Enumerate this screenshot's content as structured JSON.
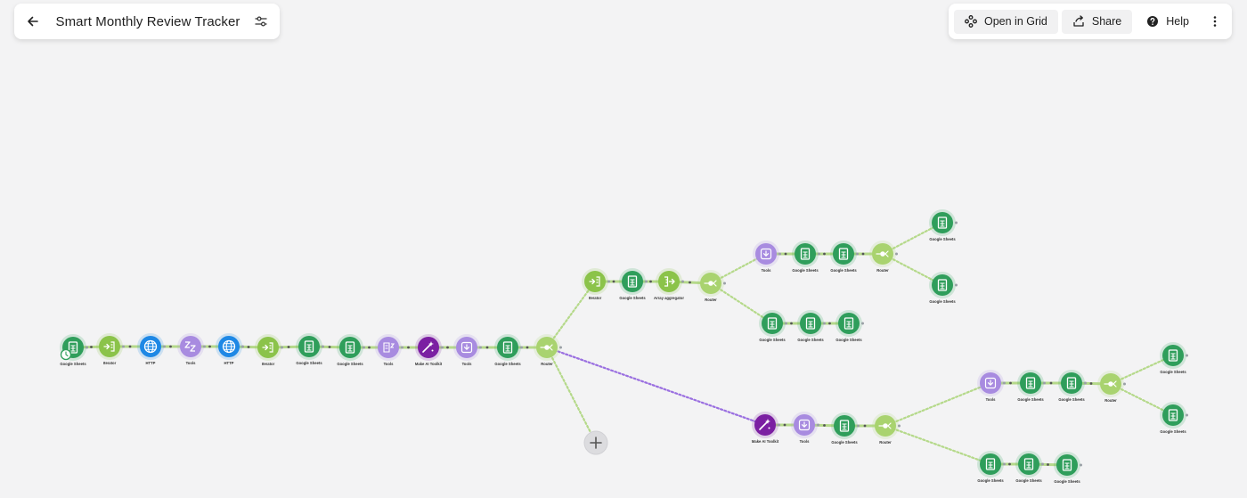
{
  "header": {
    "title": "Smart Monthly Review Tracker"
  },
  "toolbar": {
    "open_in_grid": "Open in Grid",
    "share": "Share",
    "help": "Help"
  },
  "colors": {
    "sheets": "#2f9e5b",
    "tools": "#8bc34a",
    "http": "#1e88e5",
    "ai": "#7b1fa2",
    "purple_light": "#a88be0",
    "canvas": "#f3f3f4"
  },
  "modules": [
    {
      "id": "m1",
      "kind": "sheets",
      "label": "Google Sheets"
    },
    {
      "id": "m2",
      "kind": "tools",
      "label": "Iterator"
    },
    {
      "id": "m3",
      "kind": "http",
      "label": "HTTP"
    },
    {
      "id": "m4",
      "kind": "sleep",
      "label": "Tools"
    },
    {
      "id": "m5",
      "kind": "http",
      "label": "HTTP"
    },
    {
      "id": "m6",
      "kind": "tools",
      "label": "Iterator"
    },
    {
      "id": "m7",
      "kind": "sheets",
      "label": "Google Sheets"
    },
    {
      "id": "m8",
      "kind": "sheets",
      "label": "Google Sheets"
    },
    {
      "id": "m9",
      "kind": "aggregator",
      "label": "Tools"
    },
    {
      "id": "m10",
      "kind": "ai",
      "label": "Make AI Toolkit"
    },
    {
      "id": "m11",
      "kind": "setvar",
      "label": "Tools"
    },
    {
      "id": "m12",
      "kind": "sheets",
      "label": "Google Sheets"
    },
    {
      "id": "m13",
      "kind": "router",
      "label": "Router"
    },
    {
      "id": "u1",
      "kind": "tools",
      "label": "Iterator"
    },
    {
      "id": "u2",
      "kind": "sheets",
      "label": "Google Sheets"
    },
    {
      "id": "u3",
      "kind": "arrayagg",
      "label": "Array aggregator"
    },
    {
      "id": "u4",
      "kind": "router",
      "label": "Router"
    },
    {
      "id": "a1",
      "kind": "setvar",
      "label": "Tools"
    },
    {
      "id": "a2",
      "kind": "sheets",
      "label": "Google Sheets"
    },
    {
      "id": "a3",
      "kind": "sheets",
      "label": "Google Sheets"
    },
    {
      "id": "a4",
      "kind": "router",
      "label": "Router"
    },
    {
      "id": "a5",
      "kind": "sheets",
      "label": "Google Sheets"
    },
    {
      "id": "a6",
      "kind": "sheets",
      "label": "Google Sheets"
    },
    {
      "id": "b1",
      "kind": "sheets",
      "label": "Google Sheets"
    },
    {
      "id": "b2",
      "kind": "sheets",
      "label": "Google Sheets"
    },
    {
      "id": "b3",
      "kind": "sheets",
      "label": "Google Sheets"
    },
    {
      "id": "l1",
      "kind": "ai",
      "label": "Make AI Toolkit"
    },
    {
      "id": "l2",
      "kind": "setvar",
      "label": "Tools"
    },
    {
      "id": "l3",
      "kind": "sheets",
      "label": "Google Sheets"
    },
    {
      "id": "l4",
      "kind": "router",
      "label": "Router"
    },
    {
      "id": "c1",
      "kind": "setvar",
      "label": "Tools"
    },
    {
      "id": "c2",
      "kind": "sheets",
      "label": "Google Sheets"
    },
    {
      "id": "c3",
      "kind": "sheets",
      "label": "Google Sheets"
    },
    {
      "id": "c4",
      "kind": "router",
      "label": "Router"
    },
    {
      "id": "c5",
      "kind": "sheets",
      "label": "Google Sheets"
    },
    {
      "id": "c6",
      "kind": "sheets",
      "label": "Google Sheets"
    },
    {
      "id": "d1",
      "kind": "sheets",
      "label": "Google Sheets"
    },
    {
      "id": "d2",
      "kind": "sheets",
      "label": "Google Sheets"
    },
    {
      "id": "d3",
      "kind": "sheets",
      "label": "Google Sheets"
    }
  ]
}
